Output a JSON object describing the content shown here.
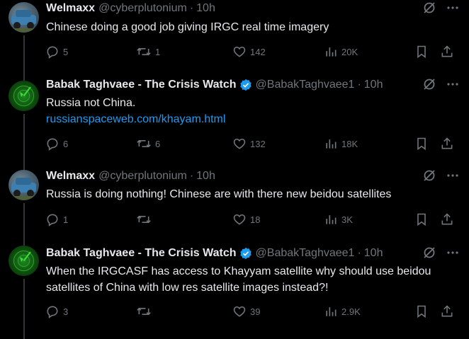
{
  "tweets": [
    {
      "name": "Welmaxx",
      "handle": "@cyberplutonium",
      "time": "10h",
      "avatar": "car-avatar",
      "verified": false,
      "text": "Chinese doing a good job giving IRGC real time imagery",
      "link": "",
      "replies": "5",
      "retweets": "1",
      "likes": "142",
      "views": "20K"
    },
    {
      "name": "Babak Taghvaee - The Crisis Watch",
      "handle": "@BabakTaghvaee1",
      "time": "10h",
      "avatar": "radar-avatar",
      "verified": true,
      "text": "Russia not China.",
      "link": "russianspaceweb.com/khayam.html",
      "replies": "6",
      "retweets": "6",
      "likes": "132",
      "views": "18K"
    },
    {
      "name": "Welmaxx",
      "handle": "@cyberplutonium",
      "time": "10h",
      "avatar": "car-avatar",
      "verified": false,
      "text": "Russia is doing nothing! Chinese are with there new beidou satellites",
      "link": "",
      "replies": "1",
      "retweets": "",
      "likes": "18",
      "views": "3K"
    },
    {
      "name": "Babak Taghvaee - The Crisis Watch",
      "handle": "@BabakTaghvaee1",
      "time": "10h",
      "avatar": "radar-avatar",
      "verified": true,
      "text_line1": "When the IRGCASF has access to Khayyam satellite why should use beidou",
      "text_line2": "satellites of China with low res satellite images instead?!",
      "replies": "3",
      "retweets": "",
      "likes": "39",
      "views": "2.9K"
    }
  ],
  "separator": "·",
  "colors": {
    "background": "#000000",
    "text": "#e7e9ea",
    "muted": "#71767b",
    "link": "#1d9bf0",
    "verified": "#1d9bf0",
    "thread_line": "#333639"
  }
}
